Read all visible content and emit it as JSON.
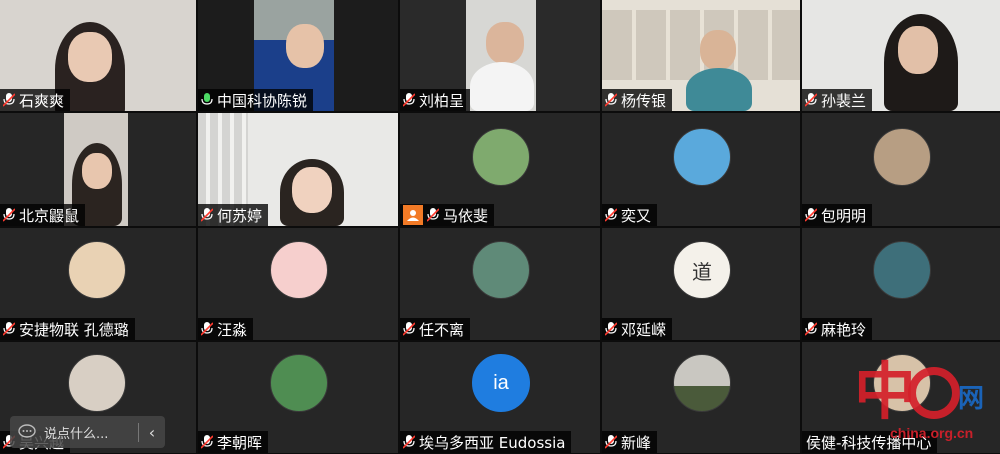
{
  "participants": [
    {
      "name": "石爽爽",
      "type": "video",
      "mic": "muted"
    },
    {
      "name": "中国科协陈锐",
      "type": "video",
      "mic": "on"
    },
    {
      "name": "刘柏呈",
      "type": "video",
      "mic": "muted"
    },
    {
      "name": "杨传银",
      "type": "video",
      "mic": "muted"
    },
    {
      "name": "孙裴兰",
      "type": "video",
      "mic": "muted"
    },
    {
      "name": "北京鼹鼠",
      "type": "video",
      "mic": "muted"
    },
    {
      "name": "何苏婷",
      "type": "video",
      "mic": "muted"
    },
    {
      "name": "马依斐",
      "type": "avatar",
      "mic": "muted",
      "host": true
    },
    {
      "name": "奕又",
      "type": "avatar",
      "mic": "muted"
    },
    {
      "name": "包明明",
      "type": "avatar",
      "mic": "muted"
    },
    {
      "name": "安捷物联 孔德璐",
      "type": "avatar",
      "mic": "muted"
    },
    {
      "name": "汪淼",
      "type": "avatar",
      "mic": "muted"
    },
    {
      "name": "任不离",
      "type": "avatar",
      "mic": "muted"
    },
    {
      "name": "邓延嵘",
      "type": "avatar",
      "mic": "muted",
      "avatar_text": "道"
    },
    {
      "name": "麻艳玲",
      "type": "avatar",
      "mic": "muted"
    },
    {
      "name": "吴兴越",
      "type": "avatar",
      "mic": "muted"
    },
    {
      "name": "李朝晖",
      "type": "avatar",
      "mic": "muted"
    },
    {
      "name": "埃乌多西亚 Eudossia",
      "type": "avatar",
      "mic": "muted",
      "avatar_text": "ia"
    },
    {
      "name": "新峰",
      "type": "avatar",
      "mic": "muted"
    },
    {
      "name": "侯健-科技传播中心",
      "type": "avatar",
      "mic": "none"
    }
  ],
  "chat": {
    "placeholder": "说点什么...",
    "collapse": "‹"
  },
  "watermark": {
    "logo_text": "中国网",
    "url": "china.org.cn"
  },
  "colors": {
    "host_badge": "#f27a26",
    "avatar_blue": "#1f7de0",
    "mic_on": "#4cd964"
  }
}
